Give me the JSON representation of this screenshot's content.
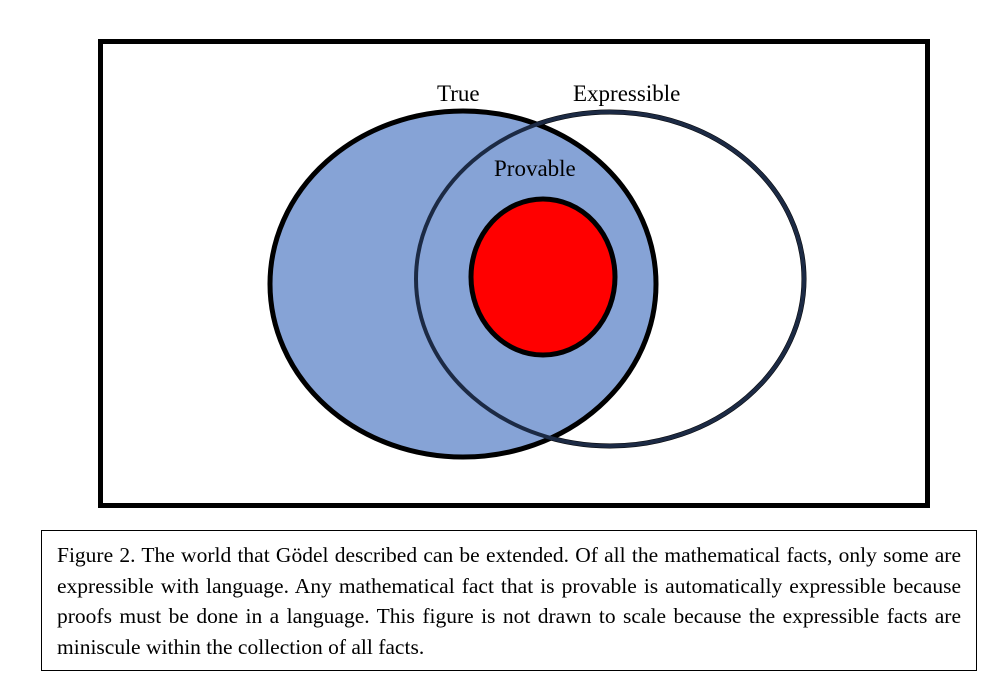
{
  "diagram": {
    "labels": {
      "true": "True",
      "expressible": "Expressible",
      "provable": "Provable"
    },
    "colors": {
      "true_fill": "#86a3d6",
      "provable_fill": "#ff0000",
      "expressible_fill": "#ffffff",
      "outline": "#000000"
    }
  },
  "caption": {
    "text": "Figure 2. The world that Gödel described can be extended. Of all the mathematical facts, only some are expressible with language. Any mathematical fact that is provable is automatically expressible because proofs must be done in a language. This figure is not drawn to scale because the expressible facts are miniscule within the collection of all facts."
  }
}
